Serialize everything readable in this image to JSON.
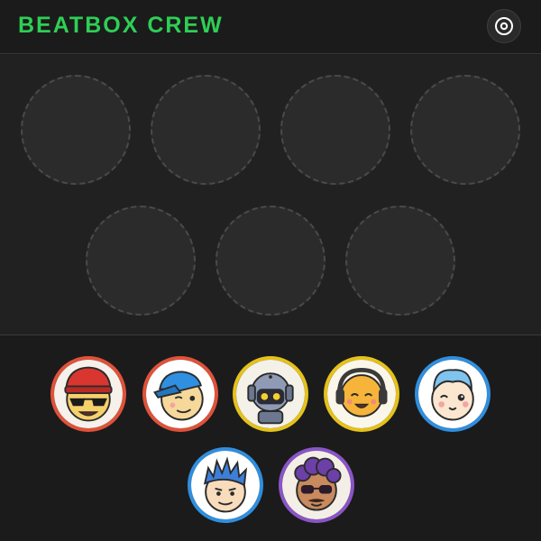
{
  "app": {
    "title": "BEATBOX CREW"
  },
  "header": {
    "settings_icon": "disc-icon"
  },
  "stage": {
    "empty_slots": 7
  },
  "tray": {
    "avatars": [
      {
        "name": "beanie-sunglasses-avatar",
        "ring_color": "#e0523a"
      },
      {
        "name": "cap-winking-avatar",
        "ring_color": "#e0523a"
      },
      {
        "name": "robot-avatar",
        "ring_color": "#e5c21a"
      },
      {
        "name": "headphones-avatar",
        "ring_color": "#e5c21a"
      },
      {
        "name": "blue-hair-winking-avatar",
        "ring_color": "#2f8fe0"
      },
      {
        "name": "spiky-hair-avatar",
        "ring_color": "#2f8fe0"
      },
      {
        "name": "curly-hair-sunglasses-avatar",
        "ring_color": "#8a55c8"
      }
    ]
  },
  "colors": {
    "accent": "#2ecf55",
    "background": "#1b1b1b",
    "stage": "#212121"
  }
}
